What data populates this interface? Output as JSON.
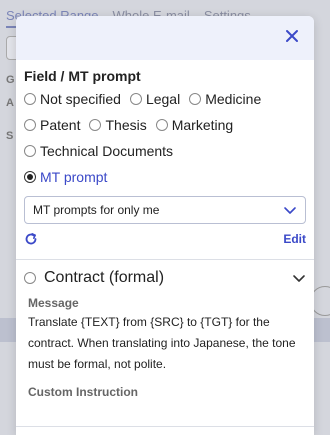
{
  "background": {
    "tabs": [
      "Selected Range",
      "Whole E-mail",
      "Settings"
    ],
    "row_labels": [
      "G",
      "A",
      "S"
    ]
  },
  "modal": {
    "field_title": "Field / MT prompt",
    "options_row1": [
      "Not specified",
      "Legal",
      "Medicine"
    ],
    "options_row2": [
      "Patent",
      "Thesis",
      "Marketing"
    ],
    "options_row3": [
      "Technical Documents"
    ],
    "selected_option": "MT prompt",
    "select_value": "MT prompts for only me",
    "edit_label": "Edit",
    "prompt": {
      "title": "Contract (formal)",
      "message_label": "Message",
      "message_text": "Translate {TEXT} from {SRC} to {TGT} for the contract. When translating into Japanese, the tone must be formal, not polite.",
      "custom_label": "Custom Instruction"
    },
    "colors": {
      "accent": "#3b49c8",
      "header_bg": "#eef1fb"
    }
  }
}
